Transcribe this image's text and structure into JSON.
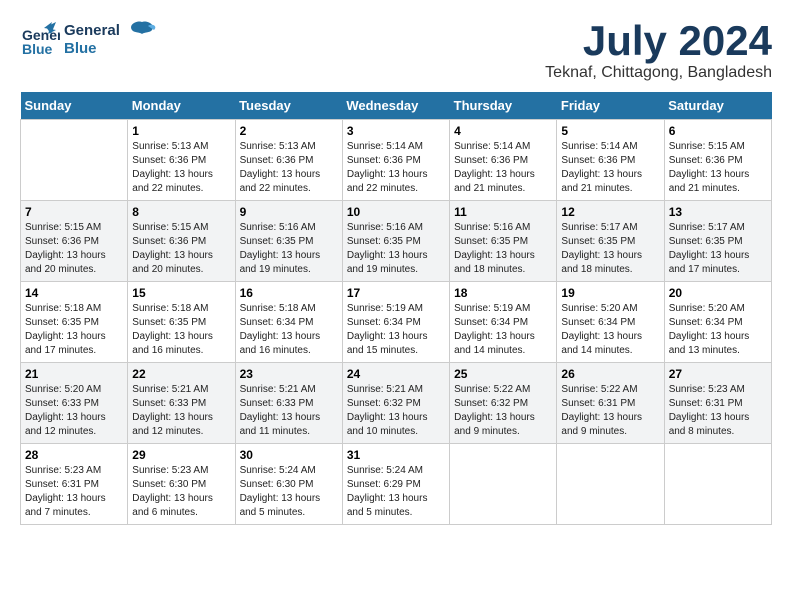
{
  "header": {
    "logo_line1": "General",
    "logo_line2": "Blue",
    "month_year": "July 2024",
    "location": "Teknaf, Chittagong, Bangladesh"
  },
  "days_of_week": [
    "Sunday",
    "Monday",
    "Tuesday",
    "Wednesday",
    "Thursday",
    "Friday",
    "Saturday"
  ],
  "weeks": [
    [
      {
        "day": "",
        "sunrise": "",
        "sunset": "",
        "daylight": ""
      },
      {
        "day": "1",
        "sunrise": "Sunrise: 5:13 AM",
        "sunset": "Sunset: 6:36 PM",
        "daylight": "Daylight: 13 hours and 22 minutes."
      },
      {
        "day": "2",
        "sunrise": "Sunrise: 5:13 AM",
        "sunset": "Sunset: 6:36 PM",
        "daylight": "Daylight: 13 hours and 22 minutes."
      },
      {
        "day": "3",
        "sunrise": "Sunrise: 5:14 AM",
        "sunset": "Sunset: 6:36 PM",
        "daylight": "Daylight: 13 hours and 22 minutes."
      },
      {
        "day": "4",
        "sunrise": "Sunrise: 5:14 AM",
        "sunset": "Sunset: 6:36 PM",
        "daylight": "Daylight: 13 hours and 21 minutes."
      },
      {
        "day": "5",
        "sunrise": "Sunrise: 5:14 AM",
        "sunset": "Sunset: 6:36 PM",
        "daylight": "Daylight: 13 hours and 21 minutes."
      },
      {
        "day": "6",
        "sunrise": "Sunrise: 5:15 AM",
        "sunset": "Sunset: 6:36 PM",
        "daylight": "Daylight: 13 hours and 21 minutes."
      }
    ],
    [
      {
        "day": "7",
        "sunrise": "Sunrise: 5:15 AM",
        "sunset": "Sunset: 6:36 PM",
        "daylight": "Daylight: 13 hours and 20 minutes."
      },
      {
        "day": "8",
        "sunrise": "Sunrise: 5:15 AM",
        "sunset": "Sunset: 6:36 PM",
        "daylight": "Daylight: 13 hours and 20 minutes."
      },
      {
        "day": "9",
        "sunrise": "Sunrise: 5:16 AM",
        "sunset": "Sunset: 6:35 PM",
        "daylight": "Daylight: 13 hours and 19 minutes."
      },
      {
        "day": "10",
        "sunrise": "Sunrise: 5:16 AM",
        "sunset": "Sunset: 6:35 PM",
        "daylight": "Daylight: 13 hours and 19 minutes."
      },
      {
        "day": "11",
        "sunrise": "Sunrise: 5:16 AM",
        "sunset": "Sunset: 6:35 PM",
        "daylight": "Daylight: 13 hours and 18 minutes."
      },
      {
        "day": "12",
        "sunrise": "Sunrise: 5:17 AM",
        "sunset": "Sunset: 6:35 PM",
        "daylight": "Daylight: 13 hours and 18 minutes."
      },
      {
        "day": "13",
        "sunrise": "Sunrise: 5:17 AM",
        "sunset": "Sunset: 6:35 PM",
        "daylight": "Daylight: 13 hours and 17 minutes."
      }
    ],
    [
      {
        "day": "14",
        "sunrise": "Sunrise: 5:18 AM",
        "sunset": "Sunset: 6:35 PM",
        "daylight": "Daylight: 13 hours and 17 minutes."
      },
      {
        "day": "15",
        "sunrise": "Sunrise: 5:18 AM",
        "sunset": "Sunset: 6:35 PM",
        "daylight": "Daylight: 13 hours and 16 minutes."
      },
      {
        "day": "16",
        "sunrise": "Sunrise: 5:18 AM",
        "sunset": "Sunset: 6:34 PM",
        "daylight": "Daylight: 13 hours and 16 minutes."
      },
      {
        "day": "17",
        "sunrise": "Sunrise: 5:19 AM",
        "sunset": "Sunset: 6:34 PM",
        "daylight": "Daylight: 13 hours and 15 minutes."
      },
      {
        "day": "18",
        "sunrise": "Sunrise: 5:19 AM",
        "sunset": "Sunset: 6:34 PM",
        "daylight": "Daylight: 13 hours and 14 minutes."
      },
      {
        "day": "19",
        "sunrise": "Sunrise: 5:20 AM",
        "sunset": "Sunset: 6:34 PM",
        "daylight": "Daylight: 13 hours and 14 minutes."
      },
      {
        "day": "20",
        "sunrise": "Sunrise: 5:20 AM",
        "sunset": "Sunset: 6:34 PM",
        "daylight": "Daylight: 13 hours and 13 minutes."
      }
    ],
    [
      {
        "day": "21",
        "sunrise": "Sunrise: 5:20 AM",
        "sunset": "Sunset: 6:33 PM",
        "daylight": "Daylight: 13 hours and 12 minutes."
      },
      {
        "day": "22",
        "sunrise": "Sunrise: 5:21 AM",
        "sunset": "Sunset: 6:33 PM",
        "daylight": "Daylight: 13 hours and 12 minutes."
      },
      {
        "day": "23",
        "sunrise": "Sunrise: 5:21 AM",
        "sunset": "Sunset: 6:33 PM",
        "daylight": "Daylight: 13 hours and 11 minutes."
      },
      {
        "day": "24",
        "sunrise": "Sunrise: 5:21 AM",
        "sunset": "Sunset: 6:32 PM",
        "daylight": "Daylight: 13 hours and 10 minutes."
      },
      {
        "day": "25",
        "sunrise": "Sunrise: 5:22 AM",
        "sunset": "Sunset: 6:32 PM",
        "daylight": "Daylight: 13 hours and 9 minutes."
      },
      {
        "day": "26",
        "sunrise": "Sunrise: 5:22 AM",
        "sunset": "Sunset: 6:31 PM",
        "daylight": "Daylight: 13 hours and 9 minutes."
      },
      {
        "day": "27",
        "sunrise": "Sunrise: 5:23 AM",
        "sunset": "Sunset: 6:31 PM",
        "daylight": "Daylight: 13 hours and 8 minutes."
      }
    ],
    [
      {
        "day": "28",
        "sunrise": "Sunrise: 5:23 AM",
        "sunset": "Sunset: 6:31 PM",
        "daylight": "Daylight: 13 hours and 7 minutes."
      },
      {
        "day": "29",
        "sunrise": "Sunrise: 5:23 AM",
        "sunset": "Sunset: 6:30 PM",
        "daylight": "Daylight: 13 hours and 6 minutes."
      },
      {
        "day": "30",
        "sunrise": "Sunrise: 5:24 AM",
        "sunset": "Sunset: 6:30 PM",
        "daylight": "Daylight: 13 hours and 5 minutes."
      },
      {
        "day": "31",
        "sunrise": "Sunrise: 5:24 AM",
        "sunset": "Sunset: 6:29 PM",
        "daylight": "Daylight: 13 hours and 5 minutes."
      },
      {
        "day": "",
        "sunrise": "",
        "sunset": "",
        "daylight": ""
      },
      {
        "day": "",
        "sunrise": "",
        "sunset": "",
        "daylight": ""
      },
      {
        "day": "",
        "sunrise": "",
        "sunset": "",
        "daylight": ""
      }
    ]
  ]
}
